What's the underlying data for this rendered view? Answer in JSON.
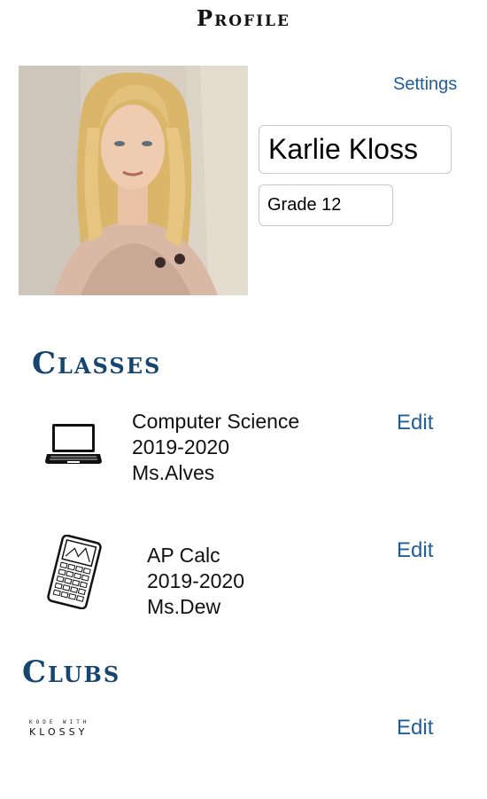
{
  "header": {
    "title": "Profile"
  },
  "profile": {
    "settings_label": "Settings",
    "name": "Karlie Kloss",
    "grade": "Grade 12"
  },
  "classes": {
    "heading": "Classes",
    "items": [
      {
        "icon": "laptop-icon",
        "name": "Computer Science",
        "year": "2019-2020",
        "teacher": "Ms.Alves",
        "edit_label": "Edit"
      },
      {
        "icon": "calculator-icon",
        "name": "AP Calc",
        "year": "2019-2020",
        "teacher": "Ms.Dew",
        "edit_label": "Edit"
      }
    ]
  },
  "clubs": {
    "heading": "Clubs",
    "items": [
      {
        "logo_top": "KODE WITH",
        "logo_main": "KLOSSY",
        "edit_label": "Edit"
      }
    ]
  },
  "colors": {
    "accent": "#1e5f9b",
    "heading": "#16466f"
  }
}
